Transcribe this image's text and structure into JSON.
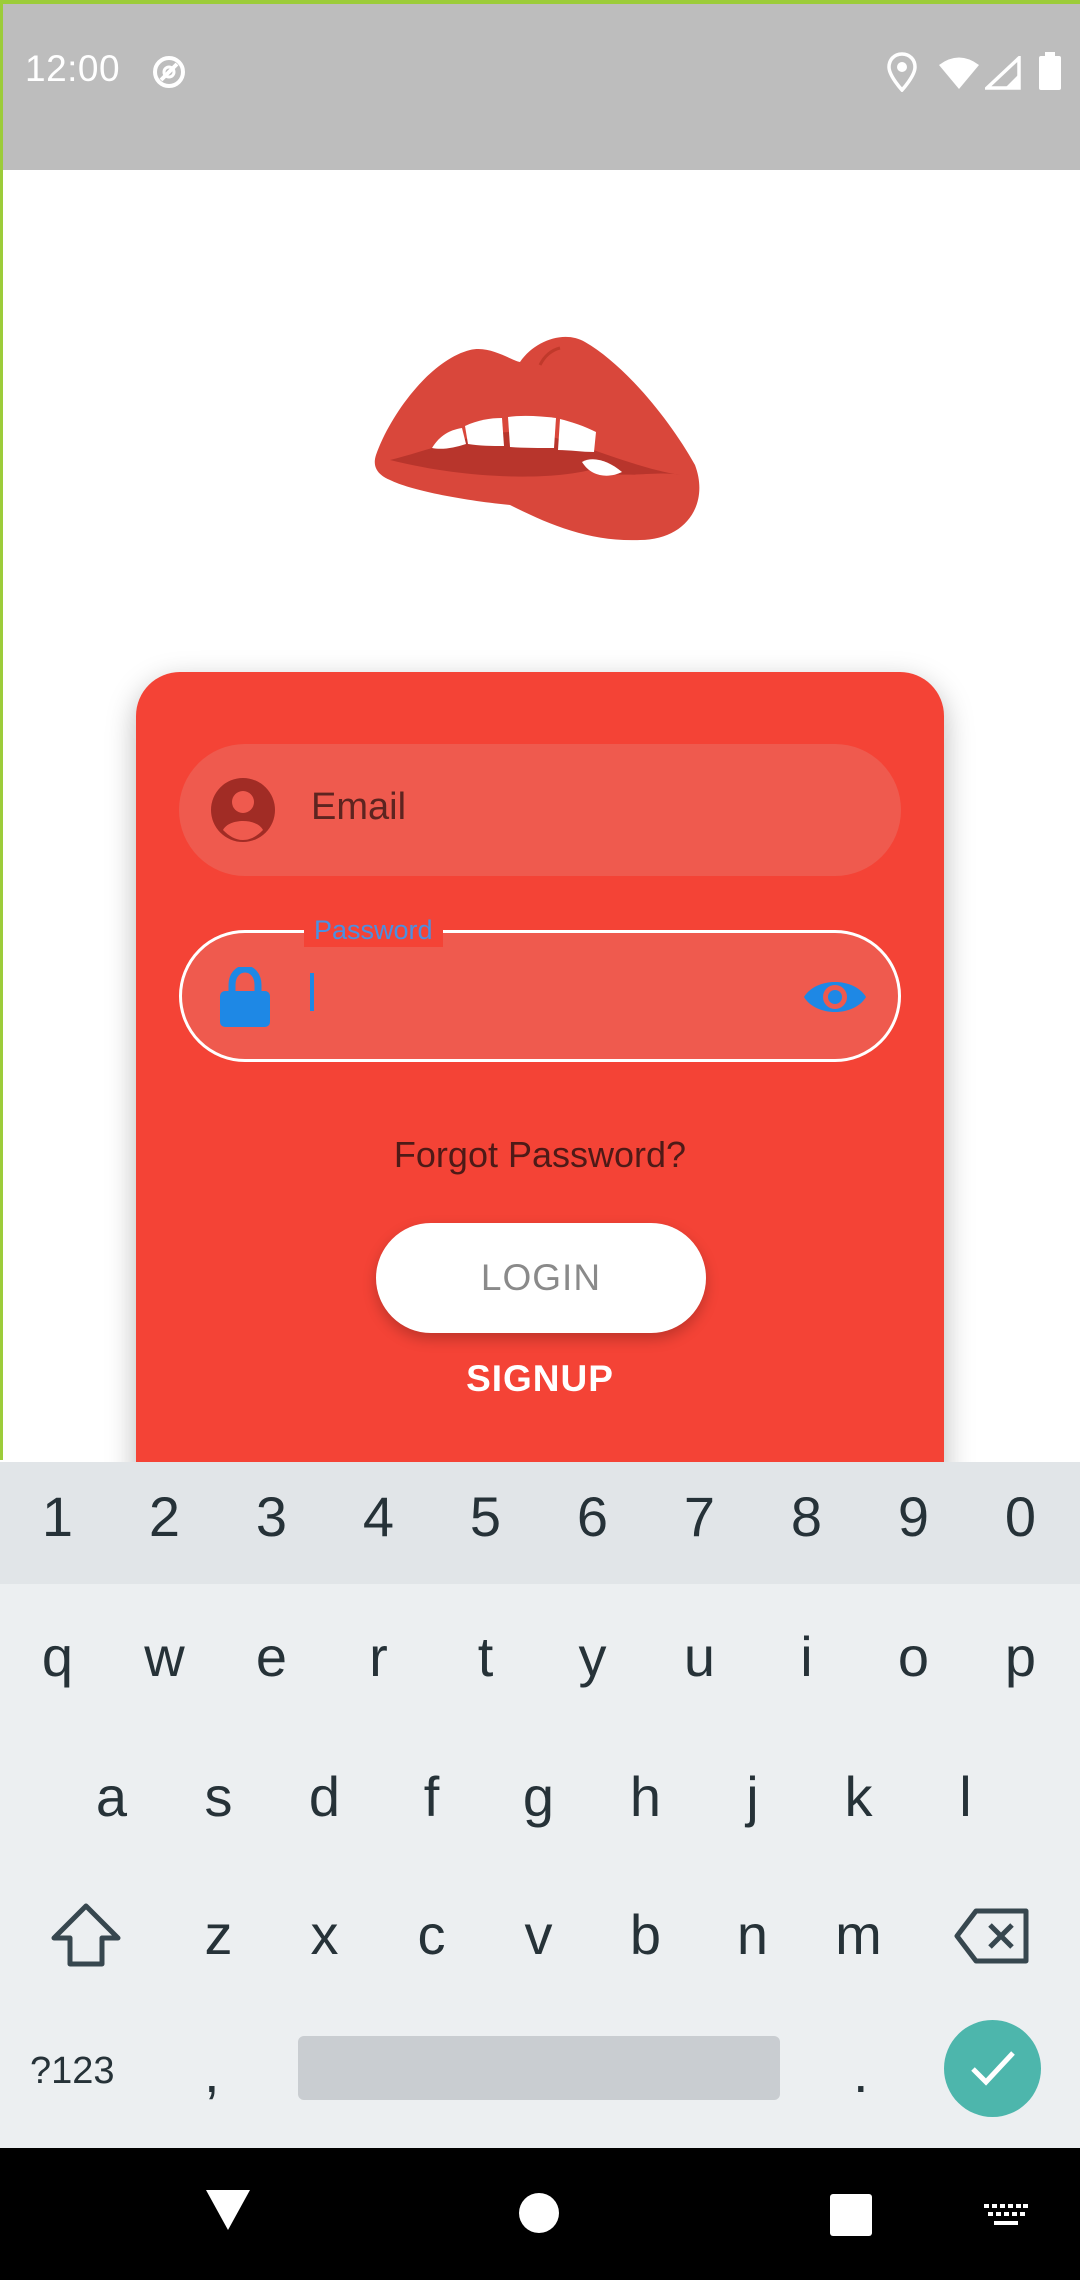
{
  "status_bar": {
    "time": "12:00",
    "icons": [
      "sync-icon",
      "location-icon",
      "wifi-icon",
      "signal-icon",
      "battery-icon"
    ]
  },
  "logo": {
    "icon": "lips-logo"
  },
  "form": {
    "email_label": "Email",
    "password_label": "Password",
    "password_value": "",
    "forgot_password": "Forgot Password?",
    "login_label": "LOGIN",
    "signup_label": "SIGNUP"
  },
  "colors": {
    "card": "#f44336",
    "field": "#ef5a4e",
    "accent_blue": "#1e88e5",
    "keyboard_bg": "#eceff1",
    "done_key": "#4db6ac"
  },
  "keyboard": {
    "numbers": [
      "1",
      "2",
      "3",
      "4",
      "5",
      "6",
      "7",
      "8",
      "9",
      "0"
    ],
    "row1": [
      "q",
      "w",
      "e",
      "r",
      "t",
      "y",
      "u",
      "i",
      "o",
      "p"
    ],
    "row2": [
      "a",
      "s",
      "d",
      "f",
      "g",
      "h",
      "j",
      "k",
      "l"
    ],
    "row3": [
      "z",
      "x",
      "c",
      "v",
      "b",
      "n",
      "m"
    ],
    "symbols_label": "?123",
    "comma": ",",
    "period": "."
  },
  "nav_bar": {
    "icons": [
      "back-icon",
      "home-icon",
      "recents-icon",
      "keyboard-icon"
    ]
  }
}
